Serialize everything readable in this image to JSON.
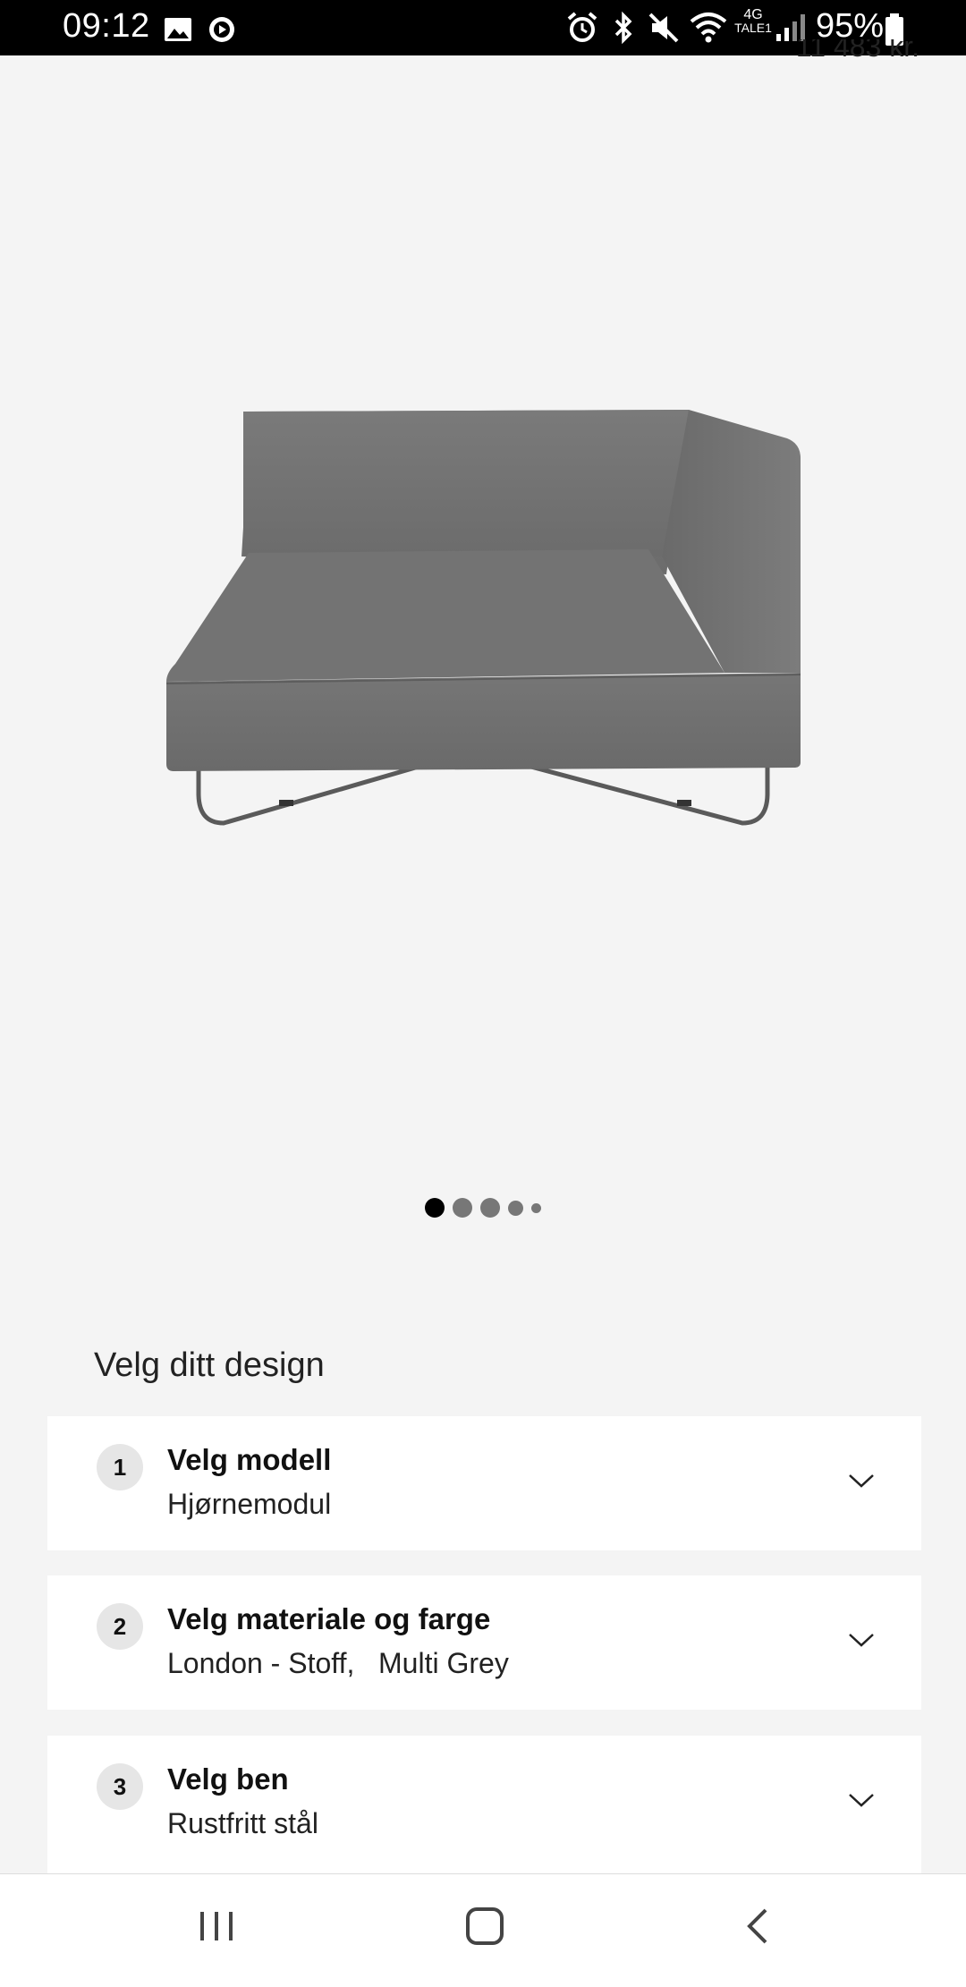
{
  "status_bar": {
    "time": "09:12",
    "network": "4G",
    "network_sub": "TALE1",
    "battery": "95%"
  },
  "product": {
    "price_partial": "11 483 kr."
  },
  "carousel": {
    "dot_count": 5,
    "active_index": 0
  },
  "configurator": {
    "heading": "Velg ditt design",
    "steps": [
      {
        "number": "1",
        "title": "Velg modell",
        "value": "Hjørnemodul"
      },
      {
        "number": "2",
        "title": "Velg materiale og farge",
        "value": "London - Stoff,   Multi Grey"
      },
      {
        "number": "3",
        "title": "Velg ben",
        "value": "Rustfritt stål"
      }
    ]
  },
  "icons": {
    "chevron": "chevron-down-icon",
    "nav_recents": "recent-apps-icon",
    "nav_home": "home-icon",
    "nav_back": "back-icon"
  },
  "colors": {
    "background": "#f4f4f4",
    "card": "#ffffff",
    "sofa": "#6e6e6e"
  }
}
